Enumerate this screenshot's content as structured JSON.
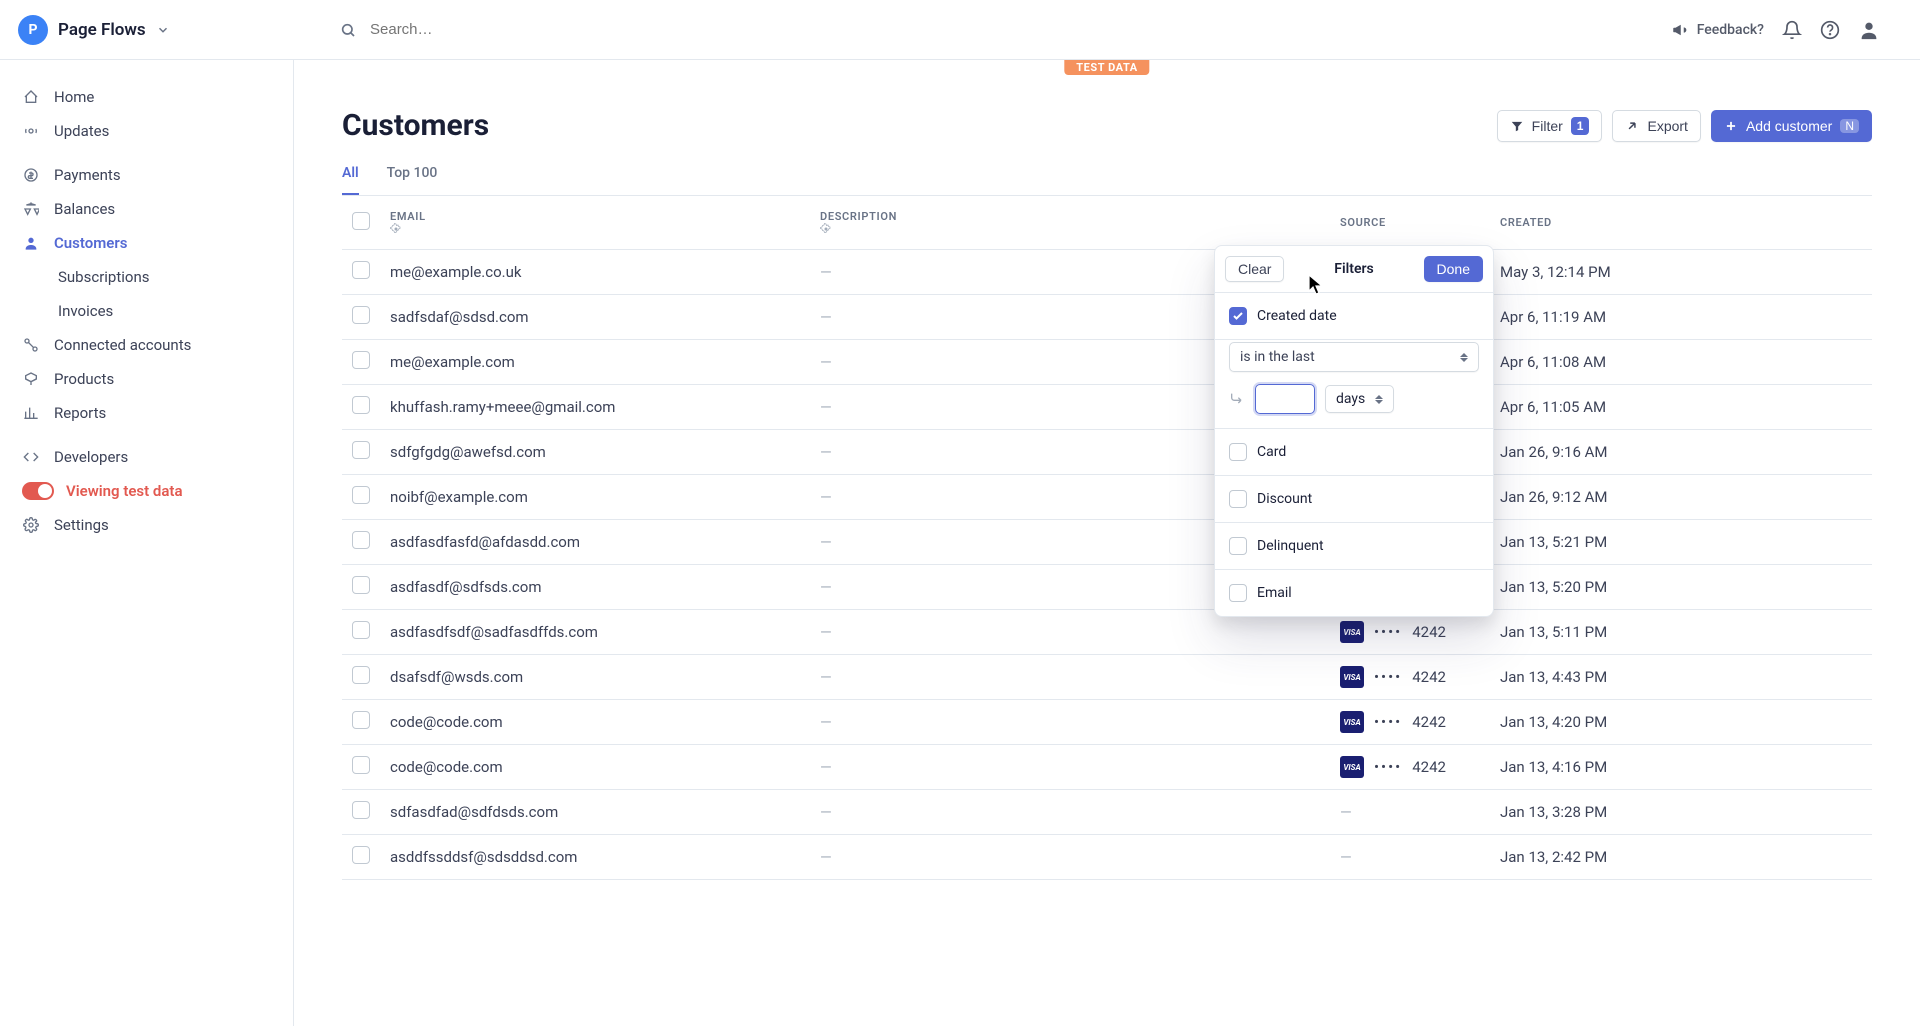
{
  "brand": {
    "logo_letter": "P",
    "name": "Page Flows"
  },
  "search": {
    "placeholder": "Search…"
  },
  "topbar": {
    "feedback": "Feedback?"
  },
  "sidebar": {
    "home": "Home",
    "updates": "Updates",
    "payments": "Payments",
    "balances": "Balances",
    "customers": "Customers",
    "subscriptions": "Subscriptions",
    "invoices": "Invoices",
    "connected": "Connected accounts",
    "products": "Products",
    "reports": "Reports",
    "developers": "Developers",
    "viewing_test": "Viewing test data",
    "settings": "Settings"
  },
  "main": {
    "test_data_tag": "TEST DATA",
    "title": "Customers",
    "actions": {
      "filter": "Filter",
      "filter_count": "1",
      "export": "Export",
      "add_customer": "Add customer",
      "add_customer_kbd": "N"
    },
    "tabs": {
      "all": "All",
      "top100": "Top 100"
    },
    "columns": {
      "email": "EMAIL",
      "description": "DESCRIPTION",
      "source": "SOURCE",
      "created": "CREATED"
    },
    "card_last4": "4242",
    "visa_label": "VISA",
    "rows": [
      {
        "email": "me@example.co.uk",
        "desc": "—",
        "card": true,
        "created": "May 3, 12:14 PM"
      },
      {
        "email": "sadfsdaf@sdsd.com",
        "desc": "—",
        "card": true,
        "created": "Apr 6, 11:19 AM"
      },
      {
        "email": "me@example.com",
        "desc": "—",
        "card": true,
        "created": "Apr 6, 11:08 AM"
      },
      {
        "email": "khuffash.ramy+meee@gmail.com",
        "desc": "—",
        "card": true,
        "created": "Apr 6, 11:05 AM"
      },
      {
        "email": "sdfgfgdg@awefsd.com",
        "desc": "—",
        "card": true,
        "created": "Jan 26, 9:16 AM"
      },
      {
        "email": "noibf@example.com",
        "desc": "—",
        "card": true,
        "created": "Jan 26, 9:12 AM"
      },
      {
        "email": "asdfasdfasfd@afdasdd.com",
        "desc": "—",
        "card": true,
        "created": "Jan 13, 5:21 PM"
      },
      {
        "email": "asdfasdf@sdfsds.com",
        "desc": "—",
        "card": true,
        "created": "Jan 13, 5:20 PM"
      },
      {
        "email": "asdfasdfsdf@sadfasdffds.com",
        "desc": "—",
        "card": true,
        "created": "Jan 13, 5:11 PM"
      },
      {
        "email": "dsafsdf@wsds.com",
        "desc": "—",
        "card": true,
        "created": "Jan 13, 4:43 PM"
      },
      {
        "email": "code@code.com",
        "desc": "—",
        "card": true,
        "created": "Jan 13, 4:20 PM"
      },
      {
        "email": "code@code.com",
        "desc": "—",
        "card": true,
        "created": "Jan 13, 4:16 PM"
      },
      {
        "email": "sdfasdfad@sdfdsds.com",
        "desc": "—",
        "card": false,
        "created": "Jan 13, 3:28 PM"
      },
      {
        "email": "asddfssddsf@sdsddsd.com",
        "desc": "—",
        "card": false,
        "created": "Jan 13, 2:42 PM"
      }
    ]
  },
  "popover": {
    "clear": "Clear",
    "title": "Filters",
    "done": "Done",
    "created_date": "Created date",
    "operator": "is in the last",
    "unit": "days",
    "opts": {
      "card": "Card",
      "discount": "Discount",
      "delinquent": "Delinquent",
      "email": "Email"
    }
  }
}
